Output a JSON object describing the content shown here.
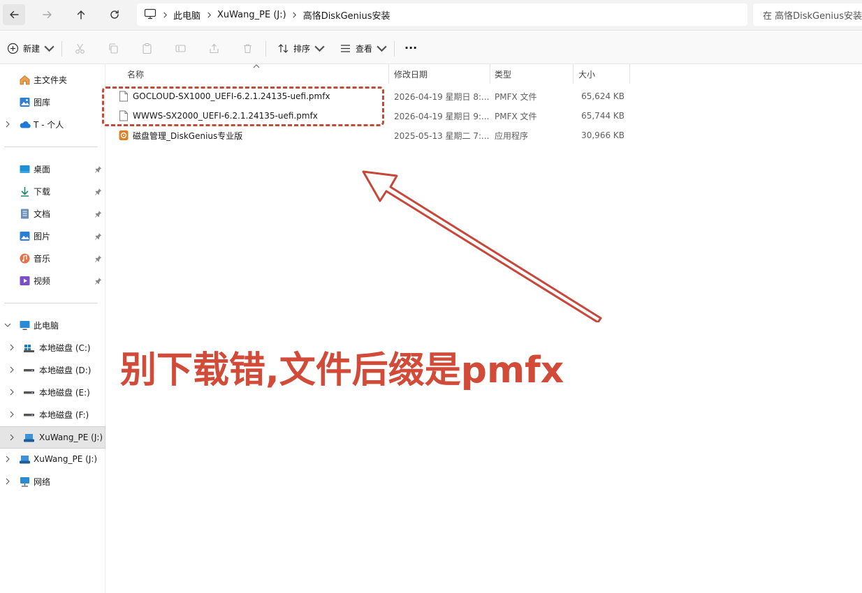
{
  "address": {
    "crumbs": [
      "此电脑",
      "XuWang_PE (J:)",
      "高恪DiskGenius安装"
    ],
    "search_placeholder": "在 高恪DiskGenius安装"
  },
  "toolbar": {
    "new_label": "新建",
    "sort_label": "排序",
    "view_label": "查看",
    "more_label": "···"
  },
  "sidebar": {
    "home": "主文件夹",
    "gallery": "图库",
    "onedrive": "T - 个人",
    "desktop": "桌面",
    "downloads": "下载",
    "documents": "文档",
    "pictures": "图片",
    "music": "音乐",
    "videos": "视频",
    "this_pc": "此电脑",
    "drive_c": "本地磁盘 (C:)",
    "drive_d": "本地磁盘 (D:)",
    "drive_e": "本地磁盘 (E:)",
    "drive_f": "本地磁盘 (F:)",
    "drive_j": "XuWang_PE (J:)",
    "drive_j2": "XuWang_PE (J:)",
    "network": "网络"
  },
  "columns": {
    "name": "名称",
    "date": "修改日期",
    "type": "类型",
    "size": "大小"
  },
  "files": [
    {
      "name": "GOCLOUD-SX1000_UEFI-6.2.1.24135-uefi.pmfx",
      "date": "2026-04-19 星期日 8:...",
      "type": "PMFX 文件",
      "size": "65,624 KB"
    },
    {
      "name": "WWWS-SX2000_UEFI-6.2.1.24135-uefi.pmfx",
      "date": "2026-04-19 星期日 9:...",
      "type": "PMFX 文件",
      "size": "65,744 KB"
    },
    {
      "name": "磁盘管理_DiskGenius专业版",
      "date": "2025-05-13 星期二 7:...",
      "type": "应用程序",
      "size": "30,966 KB"
    }
  ],
  "annotation": "别下载错,文件后缀是pmfx",
  "colors": {
    "annotation": "#d24a38",
    "highlight": "#c24a3a"
  }
}
